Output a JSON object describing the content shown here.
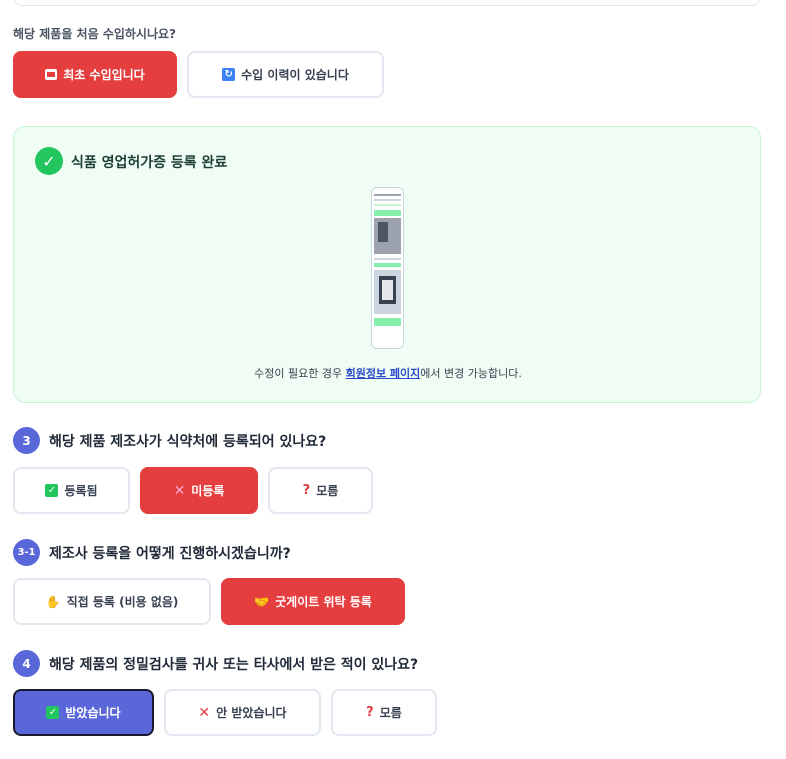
{
  "import_question": {
    "label": "해당 제품을 처음 수입하시나요?",
    "options": [
      {
        "icon": "🆕",
        "label": "최초 수입입니다",
        "selected": true
      },
      {
        "icon": "🔄",
        "label": "수입 이력이 있습니다",
        "selected": false
      }
    ]
  },
  "license_card": {
    "title": "식품 영업허가증 등록 완료",
    "note_before": "수정이 필요한 경우 ",
    "note_link": "회원정보 페이지",
    "note_after": "에서 변경 가능합니다."
  },
  "q3": {
    "number": "3",
    "title": "해당 제품 제조사가 식약처에 등록되어 있나요?",
    "options": [
      {
        "icon": "✓",
        "label": "등록됨",
        "selected": false
      },
      {
        "icon": "✕",
        "label": "미등록",
        "selected": true
      },
      {
        "icon": "?",
        "label": "모름",
        "selected": false
      }
    ]
  },
  "q3_1": {
    "number": "3-1",
    "title": "제조사 등록을 어떻게 진행하시겠습니까?",
    "options": [
      {
        "icon": "✋",
        "label": "직접 등록 (비용 없음)",
        "selected": false
      },
      {
        "icon": "🤝",
        "label": "굿게이트 위탁 등록",
        "selected": true
      }
    ]
  },
  "q4": {
    "number": "4",
    "title": "해당 제품의 정밀검사를 귀사 또는 타사에서 받은 적이 있나요?",
    "options": [
      {
        "icon": "✓",
        "label": "받았습니다",
        "selected": true
      },
      {
        "icon": "✕",
        "label": "안 받았습니다",
        "selected": false
      },
      {
        "icon": "?",
        "label": "모름",
        "selected": false
      }
    ]
  },
  "colors": {
    "red": "#e53e3e",
    "blue": "#5a67d8",
    "green": "#22c55e"
  }
}
